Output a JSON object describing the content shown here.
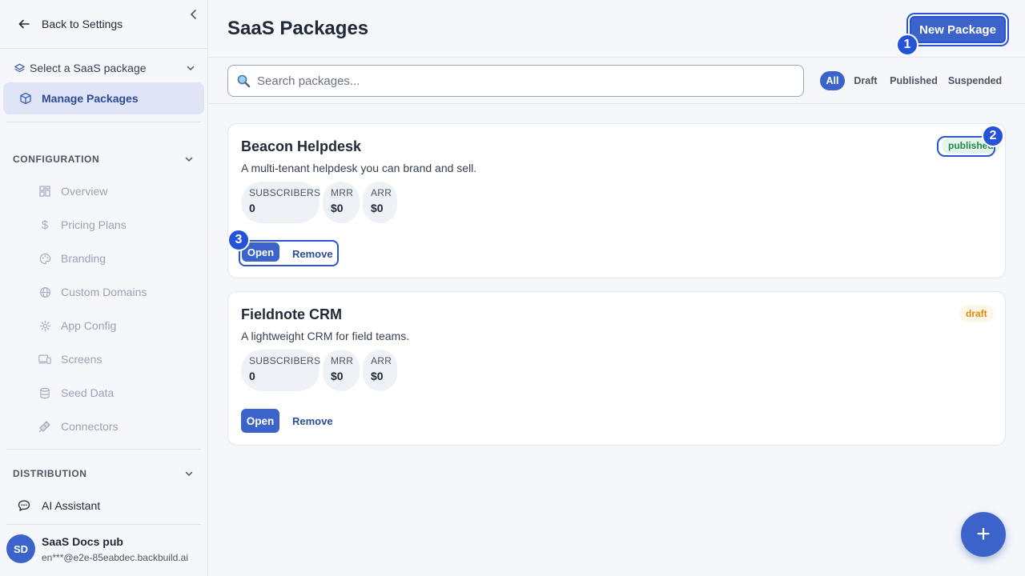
{
  "sidebar": {
    "back_label": "Back to Settings",
    "package_select_label": "Select a SaaS package",
    "active_item_label": "Manage Packages",
    "configuration": {
      "heading": "CONFIGURATION",
      "items": [
        {
          "label": "Overview",
          "icon": "grid-icon"
        },
        {
          "label": "Pricing Plans",
          "icon": "dollar-icon"
        },
        {
          "label": "Branding",
          "icon": "palette-icon"
        },
        {
          "label": "Custom Domains",
          "icon": "globe-icon"
        },
        {
          "label": "App Config",
          "icon": "gear-icon"
        },
        {
          "label": "Screens",
          "icon": "devices-icon"
        },
        {
          "label": "Seed Data",
          "icon": "database-icon"
        },
        {
          "label": "Connectors",
          "icon": "plug-icon"
        }
      ]
    },
    "distribution": {
      "heading": "DISTRIBUTION",
      "ai_label": "AI Assistant"
    },
    "user": {
      "initials": "SD",
      "name": "SaaS Docs pub",
      "email": "en***@e2e-85eabdec.backbuild.ai"
    }
  },
  "header": {
    "title": "SaaS Packages",
    "new_button": "New Package"
  },
  "search": {
    "placeholder": "Search packages..."
  },
  "filters": [
    {
      "label": "All",
      "active": true
    },
    {
      "label": "Draft",
      "active": false
    },
    {
      "label": "Published",
      "active": false
    },
    {
      "label": "Suspended",
      "active": false
    }
  ],
  "packages": [
    {
      "name": "Beacon Helpdesk",
      "description": "A multi-tenant helpdesk you can brand and sell.",
      "status": "published",
      "stats": [
        {
          "label": "SUBSCRIBERS",
          "value": "0"
        },
        {
          "label": "MRR",
          "value": "$0"
        },
        {
          "label": "ARR",
          "value": "$0"
        }
      ],
      "open_label": "Open",
      "remove_label": "Remove"
    },
    {
      "name": "Fieldnote CRM",
      "description": "A lightweight CRM for field teams.",
      "status": "draft",
      "stats": [
        {
          "label": "SUBSCRIBERS",
          "value": "0"
        },
        {
          "label": "MRR",
          "value": "$0"
        },
        {
          "label": "ARR",
          "value": "$0"
        }
      ],
      "open_label": "Open",
      "remove_label": "Remove"
    }
  ],
  "markers": [
    "1",
    "2",
    "3"
  ],
  "fab_label": "+",
  "colors": {
    "accent": "#3b63c9",
    "published": "#1f8a48",
    "draft": "#d98a13",
    "highlight": "#2a54d6"
  }
}
